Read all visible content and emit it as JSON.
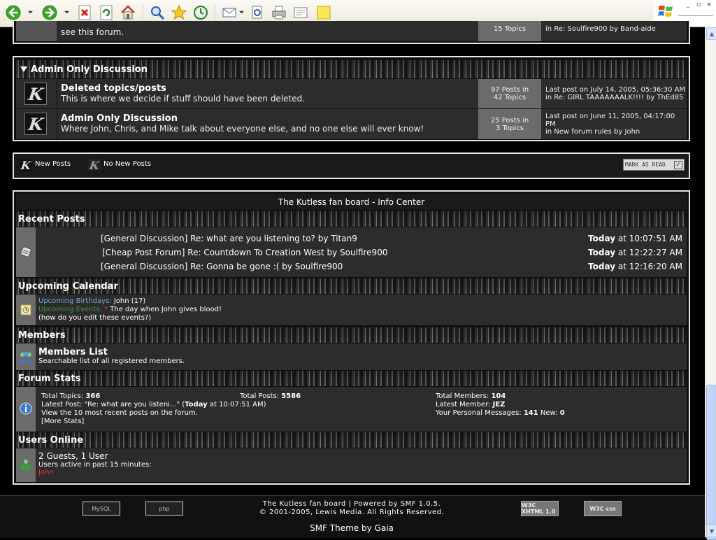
{
  "toolbar": {
    "buttons": [
      "back-icon",
      "forward-icon",
      "stop-icon",
      "refresh-icon",
      "home-icon",
      "search-icon",
      "favorites-icon",
      "history-icon",
      "mail-icon",
      "print-preview-icon",
      "print-icon",
      "edit-icon",
      "notes-icon"
    ]
  },
  "top_partial": {
    "desc": "see this forum.",
    "stats": "15 Topics",
    "last": "in Re: Soulfire900 by Band-aide"
  },
  "admin": {
    "category": "Admin Only Discussion",
    "boards": [
      {
        "title": "Deleted topics/posts",
        "desc": "This is where we decide if stuff should have been deleted.",
        "posts": "97 Posts in",
        "topics": "42 Topics",
        "last1": "Last post on July 14, 2005, 05:36:30 AM",
        "last2": "in Re: GIRL TAAAAAAALK!!!! by ThEd85"
      },
      {
        "title": "Admin Only Discussion",
        "desc": "Where John, Chris, and Mike talk about everyone else, and no one else will ever know!",
        "posts": "25 Posts in",
        "topics": "3 Topics",
        "last1": "Last post on June 11, 2005, 04:17:00 PM",
        "last2": "in New forum rules by John"
      }
    ]
  },
  "legend": {
    "new": "New Posts",
    "nonew": "No New Posts",
    "mark": "MARK AS READ"
  },
  "info": {
    "title": "The Kutless fan board - Info Center",
    "recent_header": "Recent Posts",
    "recent": [
      {
        "text": "[General Discussion] Re: what are you listening to? by Titan9",
        "today": "Today",
        "time": " at 10:07:51 AM"
      },
      {
        "text": "[Cheap Post Forum] Re: Countdown To Creation West by Soulfire900",
        "today": "Today",
        "time": " at 12:22:27 AM"
      },
      {
        "text": "[General Discussion] Re: Gonna be gone :( by Soulfire900",
        "today": "Today",
        "time": " at 12:16:20 AM"
      }
    ],
    "calendar_header": "Upcoming Calendar",
    "birthdays_label": "Upcoming Birthdays:",
    "birthdays_value": "John (17)",
    "events_label": "Upcoming Events:",
    "events_star": "*",
    "events_value": "The day when John gives blood!",
    "events_note": "(how do you edit these events?)",
    "members_header": "Members",
    "members_title": "Members List",
    "members_desc": "Searchable list of all registered members.",
    "stats_header": "Forum Stats",
    "stats": {
      "total_topics_label": "Total Topics: ",
      "total_topics": "366",
      "total_posts_label": "Total Posts: ",
      "total_posts": "5586",
      "total_members_label": "Total Members: ",
      "total_members": "104",
      "latest_post_label": "Latest Post: \"Re: what are you listeni...\" (",
      "latest_post_today": "Today",
      "latest_post_time": " at 10:07:51 AM)",
      "latest_member_label": "Latest Member: ",
      "latest_member": "JEZ",
      "recent_link": "View the 10 most recent posts on the forum.",
      "pm_label": "Your Personal Messages: ",
      "pm": "141",
      "new_label": " New: ",
      "new": "0",
      "more": "[More Stats]"
    },
    "online_header": "Users Online",
    "online_count": "2 Guests, 1 User",
    "online_desc": "Users active in past 15 minutes:",
    "online_user": "John"
  },
  "footer": {
    "line1": "The Kutless fan board | Powered by SMF 1.0.5.",
    "line2": "© 2001-2005, Lewis Media. All Rights Reserved.",
    "theme": "SMF Theme by Gaia",
    "badge_mysql": "MySQL",
    "badge_php": "php",
    "badge_xhtml": "W3C XHTML 1.0",
    "badge_css": "W3C css"
  },
  "colors": {
    "birthday": "#6fa8dc",
    "event": "#3a9a3a",
    "online_user": "#ff2a2a",
    "accent_bg": "#2c2c2c"
  }
}
